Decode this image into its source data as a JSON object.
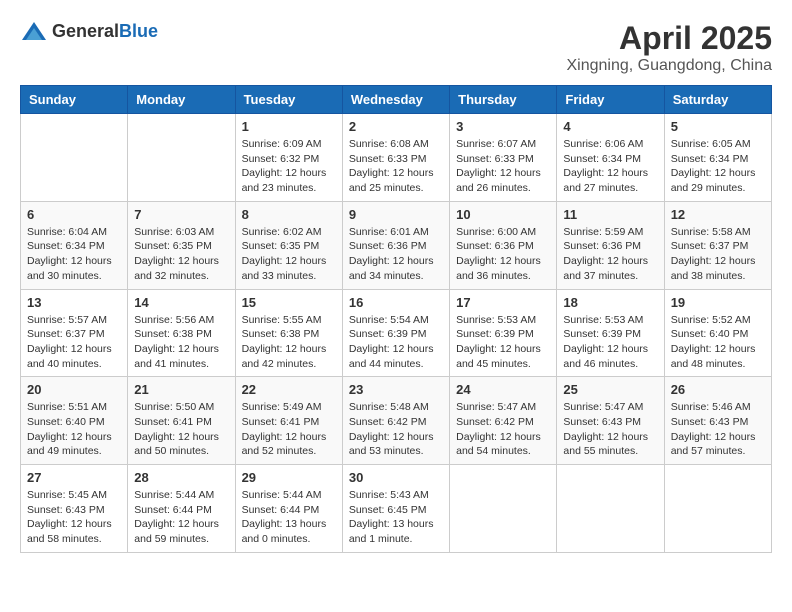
{
  "header": {
    "logo_general": "General",
    "logo_blue": "Blue",
    "month_title": "April 2025",
    "location": "Xingning, Guangdong, China"
  },
  "weekdays": [
    "Sunday",
    "Monday",
    "Tuesday",
    "Wednesday",
    "Thursday",
    "Friday",
    "Saturday"
  ],
  "weeks": [
    [
      {
        "day": "",
        "info": ""
      },
      {
        "day": "",
        "info": ""
      },
      {
        "day": "1",
        "info": "Sunrise: 6:09 AM\nSunset: 6:32 PM\nDaylight: 12 hours and 23 minutes."
      },
      {
        "day": "2",
        "info": "Sunrise: 6:08 AM\nSunset: 6:33 PM\nDaylight: 12 hours and 25 minutes."
      },
      {
        "day": "3",
        "info": "Sunrise: 6:07 AM\nSunset: 6:33 PM\nDaylight: 12 hours and 26 minutes."
      },
      {
        "day": "4",
        "info": "Sunrise: 6:06 AM\nSunset: 6:34 PM\nDaylight: 12 hours and 27 minutes."
      },
      {
        "day": "5",
        "info": "Sunrise: 6:05 AM\nSunset: 6:34 PM\nDaylight: 12 hours and 29 minutes."
      }
    ],
    [
      {
        "day": "6",
        "info": "Sunrise: 6:04 AM\nSunset: 6:34 PM\nDaylight: 12 hours and 30 minutes."
      },
      {
        "day": "7",
        "info": "Sunrise: 6:03 AM\nSunset: 6:35 PM\nDaylight: 12 hours and 32 minutes."
      },
      {
        "day": "8",
        "info": "Sunrise: 6:02 AM\nSunset: 6:35 PM\nDaylight: 12 hours and 33 minutes."
      },
      {
        "day": "9",
        "info": "Sunrise: 6:01 AM\nSunset: 6:36 PM\nDaylight: 12 hours and 34 minutes."
      },
      {
        "day": "10",
        "info": "Sunrise: 6:00 AM\nSunset: 6:36 PM\nDaylight: 12 hours and 36 minutes."
      },
      {
        "day": "11",
        "info": "Sunrise: 5:59 AM\nSunset: 6:36 PM\nDaylight: 12 hours and 37 minutes."
      },
      {
        "day": "12",
        "info": "Sunrise: 5:58 AM\nSunset: 6:37 PM\nDaylight: 12 hours and 38 minutes."
      }
    ],
    [
      {
        "day": "13",
        "info": "Sunrise: 5:57 AM\nSunset: 6:37 PM\nDaylight: 12 hours and 40 minutes."
      },
      {
        "day": "14",
        "info": "Sunrise: 5:56 AM\nSunset: 6:38 PM\nDaylight: 12 hours and 41 minutes."
      },
      {
        "day": "15",
        "info": "Sunrise: 5:55 AM\nSunset: 6:38 PM\nDaylight: 12 hours and 42 minutes."
      },
      {
        "day": "16",
        "info": "Sunrise: 5:54 AM\nSunset: 6:39 PM\nDaylight: 12 hours and 44 minutes."
      },
      {
        "day": "17",
        "info": "Sunrise: 5:53 AM\nSunset: 6:39 PM\nDaylight: 12 hours and 45 minutes."
      },
      {
        "day": "18",
        "info": "Sunrise: 5:53 AM\nSunset: 6:39 PM\nDaylight: 12 hours and 46 minutes."
      },
      {
        "day": "19",
        "info": "Sunrise: 5:52 AM\nSunset: 6:40 PM\nDaylight: 12 hours and 48 minutes."
      }
    ],
    [
      {
        "day": "20",
        "info": "Sunrise: 5:51 AM\nSunset: 6:40 PM\nDaylight: 12 hours and 49 minutes."
      },
      {
        "day": "21",
        "info": "Sunrise: 5:50 AM\nSunset: 6:41 PM\nDaylight: 12 hours and 50 minutes."
      },
      {
        "day": "22",
        "info": "Sunrise: 5:49 AM\nSunset: 6:41 PM\nDaylight: 12 hours and 52 minutes."
      },
      {
        "day": "23",
        "info": "Sunrise: 5:48 AM\nSunset: 6:42 PM\nDaylight: 12 hours and 53 minutes."
      },
      {
        "day": "24",
        "info": "Sunrise: 5:47 AM\nSunset: 6:42 PM\nDaylight: 12 hours and 54 minutes."
      },
      {
        "day": "25",
        "info": "Sunrise: 5:47 AM\nSunset: 6:43 PM\nDaylight: 12 hours and 55 minutes."
      },
      {
        "day": "26",
        "info": "Sunrise: 5:46 AM\nSunset: 6:43 PM\nDaylight: 12 hours and 57 minutes."
      }
    ],
    [
      {
        "day": "27",
        "info": "Sunrise: 5:45 AM\nSunset: 6:43 PM\nDaylight: 12 hours and 58 minutes."
      },
      {
        "day": "28",
        "info": "Sunrise: 5:44 AM\nSunset: 6:44 PM\nDaylight: 12 hours and 59 minutes."
      },
      {
        "day": "29",
        "info": "Sunrise: 5:44 AM\nSunset: 6:44 PM\nDaylight: 13 hours and 0 minutes."
      },
      {
        "day": "30",
        "info": "Sunrise: 5:43 AM\nSunset: 6:45 PM\nDaylight: 13 hours and 1 minute."
      },
      {
        "day": "",
        "info": ""
      },
      {
        "day": "",
        "info": ""
      },
      {
        "day": "",
        "info": ""
      }
    ]
  ]
}
